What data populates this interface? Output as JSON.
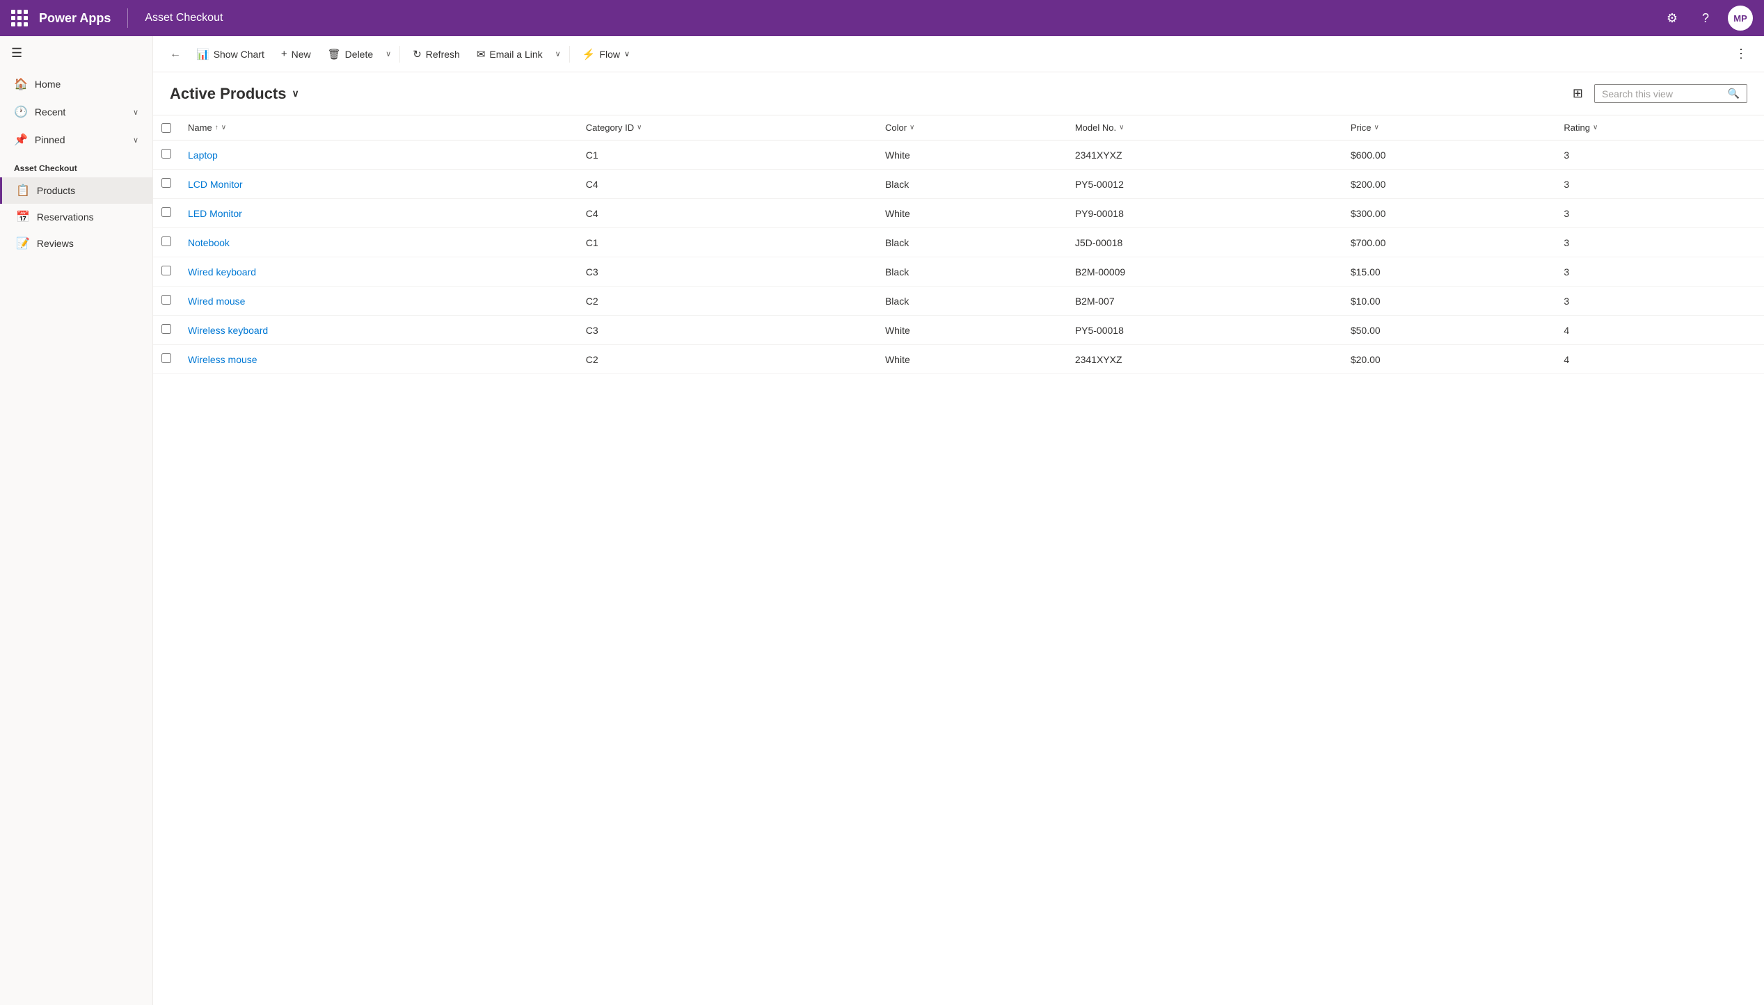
{
  "header": {
    "waffle_label": "Apps",
    "app_name": "Power Apps",
    "page_subtitle": "Asset Checkout",
    "settings_label": "Settings",
    "help_label": "Help",
    "avatar_initials": "MP"
  },
  "sidebar": {
    "hamburger_label": "Menu",
    "nav_items": [
      {
        "id": "home",
        "icon": "🏠",
        "label": "Home",
        "has_chevron": false
      },
      {
        "id": "recent",
        "icon": "🕐",
        "label": "Recent",
        "has_chevron": true
      },
      {
        "id": "pinned",
        "icon": "📌",
        "label": "Pinned",
        "has_chevron": true
      }
    ],
    "section_label": "Asset Checkout",
    "app_items": [
      {
        "id": "products",
        "icon": "📋",
        "label": "Products",
        "active": true
      },
      {
        "id": "reservations",
        "icon": "📅",
        "label": "Reservations",
        "active": false
      },
      {
        "id": "reviews",
        "icon": "📝",
        "label": "Reviews",
        "active": false
      }
    ]
  },
  "toolbar": {
    "back_label": "Back",
    "show_chart_label": "Show Chart",
    "new_label": "New",
    "delete_label": "Delete",
    "refresh_label": "Refresh",
    "email_link_label": "Email a Link",
    "flow_label": "Flow",
    "more_label": "More"
  },
  "view": {
    "title": "Active Products",
    "filter_label": "Filter",
    "search_placeholder": "Search this view",
    "columns": [
      {
        "id": "name",
        "label": "Name",
        "sort": "asc",
        "has_chevron": true
      },
      {
        "id": "category",
        "label": "Category ID",
        "has_chevron": true
      },
      {
        "id": "color",
        "label": "Color",
        "has_chevron": true
      },
      {
        "id": "model",
        "label": "Model No.",
        "has_chevron": true
      },
      {
        "id": "price",
        "label": "Price",
        "has_chevron": true
      },
      {
        "id": "rating",
        "label": "Rating",
        "has_chevron": true
      }
    ],
    "rows": [
      {
        "name": "Laptop",
        "category": "C1",
        "color": "White",
        "model": "2341XYXZ",
        "price": "$600.00",
        "rating": "3"
      },
      {
        "name": "LCD Monitor",
        "category": "C4",
        "color": "Black",
        "model": "PY5-00012",
        "price": "$200.00",
        "rating": "3"
      },
      {
        "name": "LED Monitor",
        "category": "C4",
        "color": "White",
        "model": "PY9-00018",
        "price": "$300.00",
        "rating": "3"
      },
      {
        "name": "Notebook",
        "category": "C1",
        "color": "Black",
        "model": "J5D-00018",
        "price": "$700.00",
        "rating": "3"
      },
      {
        "name": "Wired keyboard",
        "category": "C3",
        "color": "Black",
        "model": "B2M-00009",
        "price": "$15.00",
        "rating": "3"
      },
      {
        "name": "Wired mouse",
        "category": "C2",
        "color": "Black",
        "model": "B2M-007",
        "price": "$10.00",
        "rating": "3"
      },
      {
        "name": "Wireless keyboard",
        "category": "C3",
        "color": "White",
        "model": "PY5-00018",
        "price": "$50.00",
        "rating": "4"
      },
      {
        "name": "Wireless mouse",
        "category": "C2",
        "color": "White",
        "model": "2341XYXZ",
        "price": "$20.00",
        "rating": "4"
      }
    ]
  },
  "colors": {
    "purple": "#6b2d8b",
    "link_blue": "#0078d4",
    "border": "#edebe9",
    "text_primary": "#323130",
    "text_secondary": "#605e5c"
  }
}
